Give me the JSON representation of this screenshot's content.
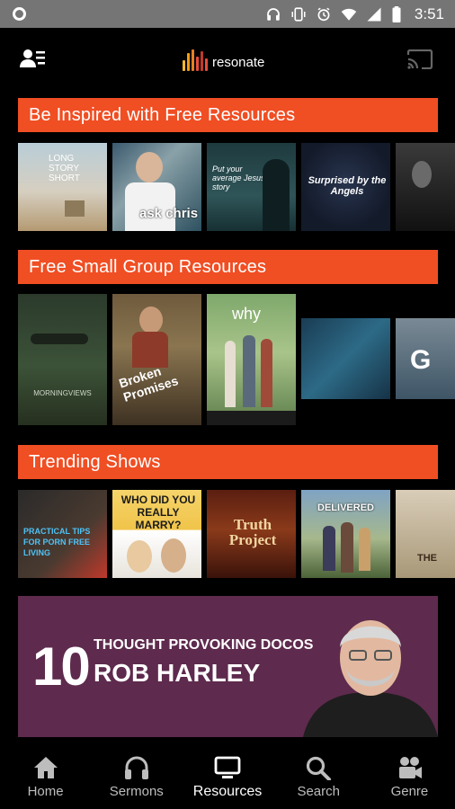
{
  "status_bar": {
    "time": "3:51"
  },
  "app": {
    "logo_text": "resonate"
  },
  "sections": [
    {
      "title": "Be Inspired with Free Resources",
      "items": [
        {
          "caption": "LONG STORY SHORT"
        },
        {
          "caption": "ask chris"
        },
        {
          "caption": "Put your average Jesus story"
        },
        {
          "caption": "Surprised by the Angels"
        },
        {
          "caption": ""
        }
      ]
    },
    {
      "title": "Free Small Group Resources",
      "items": [
        {
          "caption": "MORNINGVIEWS"
        },
        {
          "caption": "Broken Promises"
        },
        {
          "caption": "why"
        },
        {
          "caption": ""
        },
        {
          "caption": "G"
        }
      ]
    },
    {
      "title": "Trending Shows",
      "items": [
        {
          "caption": "PRACTICAL TIPS FOR PORN FREE LIVING"
        },
        {
          "caption": "WHO DID YOU REALLY MARRY?"
        },
        {
          "caption": "Truth Project"
        },
        {
          "caption": "DELIVERED"
        },
        {
          "caption": "THE"
        }
      ]
    }
  ],
  "banner": {
    "number": "10",
    "line1": "THOUGHT PROVOKING DOCOS",
    "line2": "ROB HARLEY"
  },
  "nav": {
    "items": [
      {
        "label": "Home",
        "icon": "home-icon"
      },
      {
        "label": "Sermons",
        "icon": "headphones-icon"
      },
      {
        "label": "Resources",
        "icon": "monitor-icon"
      },
      {
        "label": "Search",
        "icon": "search-icon"
      },
      {
        "label": "Genre",
        "icon": "genre-icon"
      }
    ],
    "active": "Resources"
  },
  "colors": {
    "accent": "#f04e23",
    "banner_bg": "#5e2a4d",
    "status_bar": "#757575"
  }
}
